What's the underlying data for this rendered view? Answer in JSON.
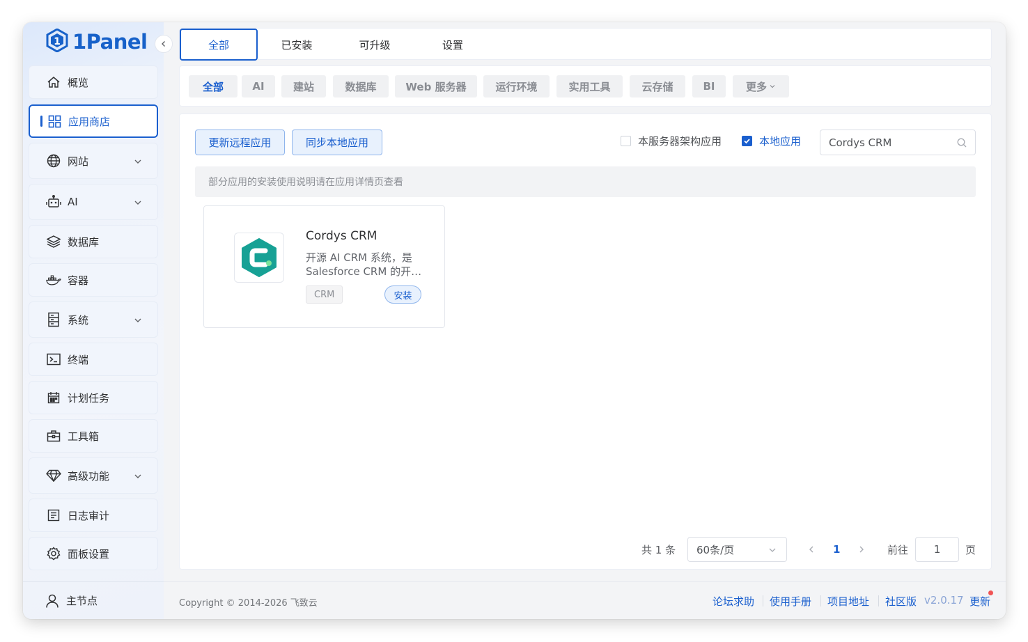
{
  "app": {
    "logo_text": "1Panel"
  },
  "sidebar": {
    "items": [
      {
        "label": "概览",
        "icon": "home-icon",
        "expandable": false
      },
      {
        "label": "应用商店",
        "icon": "grid-icon",
        "expandable": false,
        "active": true
      },
      {
        "label": "网站",
        "icon": "globe-icon",
        "expandable": true
      },
      {
        "label": "AI",
        "icon": "robot-icon",
        "expandable": true
      },
      {
        "label": "数据库",
        "icon": "layers-icon",
        "expandable": false
      },
      {
        "label": "容器",
        "icon": "docker-icon",
        "expandable": false
      },
      {
        "label": "系统",
        "icon": "server-icon",
        "expandable": true
      },
      {
        "label": "终端",
        "icon": "terminal-icon",
        "expandable": false
      },
      {
        "label": "计划任务",
        "icon": "calendar-icon",
        "expandable": false
      },
      {
        "label": "工具箱",
        "icon": "toolbox-icon",
        "expandable": false
      },
      {
        "label": "高级功能",
        "icon": "diamond-icon",
        "expandable": true
      },
      {
        "label": "日志审计",
        "icon": "log-icon",
        "expandable": false
      },
      {
        "label": "面板设置",
        "icon": "gear-icon",
        "expandable": false
      }
    ],
    "bottom_label": "主节点"
  },
  "top_tabs": [
    {
      "label": "全部",
      "active": true
    },
    {
      "label": "已安装"
    },
    {
      "label": "可升级"
    },
    {
      "label": "设置"
    }
  ],
  "categories": [
    {
      "label": "全部",
      "active": true
    },
    {
      "label": "AI"
    },
    {
      "label": "建站"
    },
    {
      "label": "数据库"
    },
    {
      "label": "Web 服务器"
    },
    {
      "label": "运行环境"
    },
    {
      "label": "实用工具"
    },
    {
      "label": "云存储"
    },
    {
      "label": "BI"
    },
    {
      "label": "更多"
    }
  ],
  "toolbar": {
    "update_remote": "更新远程应用",
    "sync_local": "同步本地应用",
    "arch_filter": {
      "label": "本服务器架构应用",
      "checked": false
    },
    "local_filter": {
      "label": "本地应用",
      "checked": true
    },
    "search_value": "Cordys CRM"
  },
  "notice": "部分应用的安装使用说明请在应用详情页查看",
  "apps": [
    {
      "name": "Cordys CRM",
      "desc_line1": "开源 AI CRM 系统，是",
      "desc_line2": "Salesforce CRM 的开源替代方案",
      "tag": "CRM",
      "install_label": "安装",
      "icon_color": "#17a195"
    }
  ],
  "pagination": {
    "total_text": "共 1 条",
    "page_size": "60条/页",
    "current_page": "1",
    "goto_label": "前往",
    "goto_value": "1",
    "page_suffix": "页"
  },
  "footer": {
    "copyright": "Copyright © 2014-2026 飞致云",
    "links": [
      "论坛求助",
      "使用手册",
      "项目地址",
      "社区版"
    ],
    "version": "v2.0.17",
    "update": "更新"
  },
  "colors": {
    "accent": "#1a5fce",
    "badge": "#f05454"
  }
}
